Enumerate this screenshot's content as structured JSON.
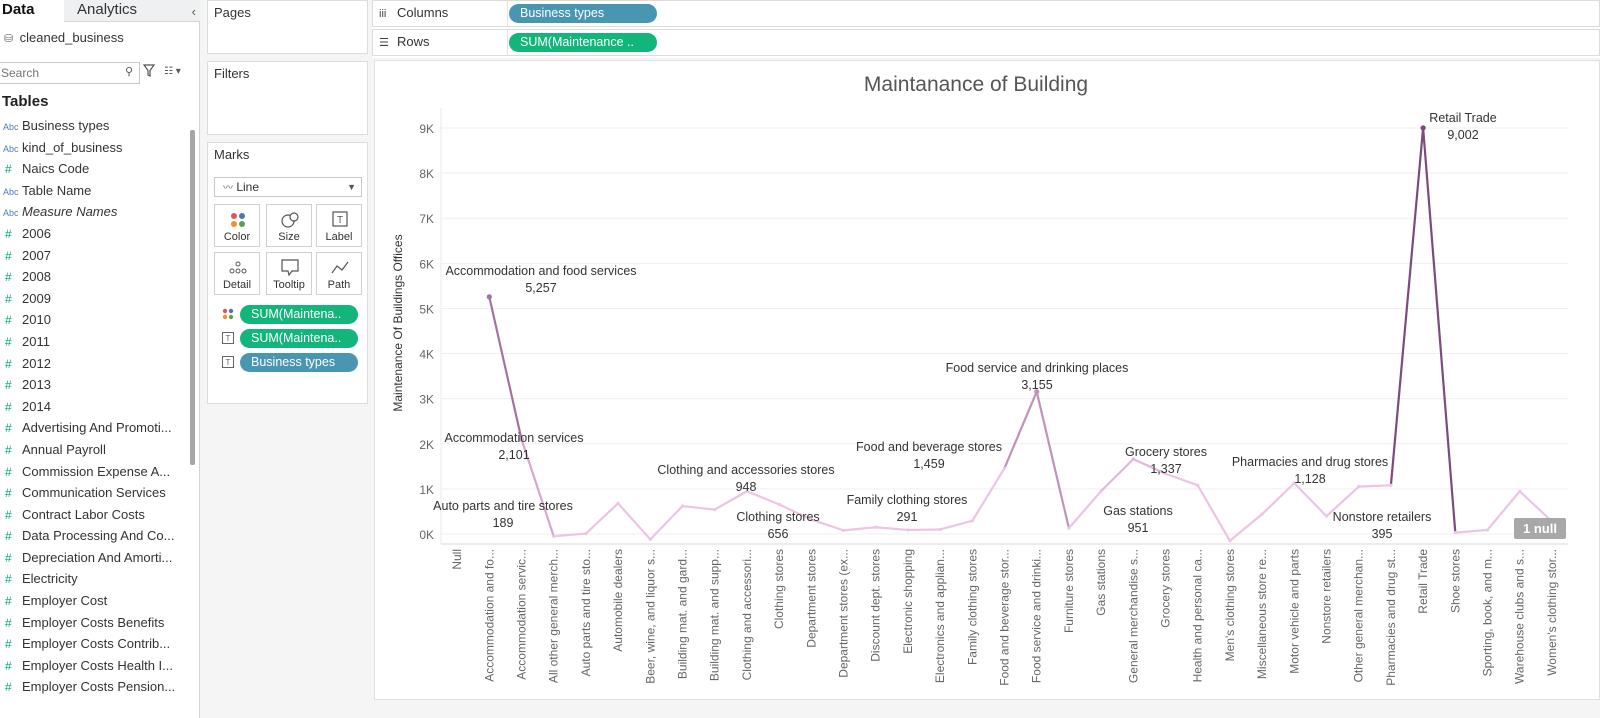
{
  "data_pane": {
    "tabs": [
      "Data",
      "Analytics"
    ],
    "collapse_glyph": "‹",
    "datasource": "cleaned_business",
    "search_placeholder": "Search",
    "tables_title": "Tables",
    "fields": [
      {
        "type": "Abc",
        "name": "Business types",
        "italic": false
      },
      {
        "type": "Abc",
        "name": "kind_of_business",
        "italic": false
      },
      {
        "type": "#",
        "name": "Naics Code",
        "italic": false
      },
      {
        "type": "Abc",
        "name": "Table Name",
        "italic": false
      },
      {
        "type": "Abc",
        "name": "Measure Names",
        "italic": true
      },
      {
        "type": "#",
        "name": "2006",
        "italic": false
      },
      {
        "type": "#",
        "name": "2007",
        "italic": false
      },
      {
        "type": "#",
        "name": "2008",
        "italic": false
      },
      {
        "type": "#",
        "name": "2009",
        "italic": false
      },
      {
        "type": "#",
        "name": "2010",
        "italic": false
      },
      {
        "type": "#",
        "name": "2011",
        "italic": false
      },
      {
        "type": "#",
        "name": "2012",
        "italic": false
      },
      {
        "type": "#",
        "name": "2013",
        "italic": false
      },
      {
        "type": "#",
        "name": "2014",
        "italic": false
      },
      {
        "type": "#",
        "name": "Advertising And Promoti...",
        "italic": false
      },
      {
        "type": "#",
        "name": "Annual Payroll",
        "italic": false
      },
      {
        "type": "#",
        "name": "Commission Expense A...",
        "italic": false
      },
      {
        "type": "#",
        "name": "Communication Services",
        "italic": false
      },
      {
        "type": "#",
        "name": "Contract Labor Costs",
        "italic": false
      },
      {
        "type": "#",
        "name": "Data Processing And Co...",
        "italic": false
      },
      {
        "type": "#",
        "name": "Depreciation And Amorti...",
        "italic": false
      },
      {
        "type": "#",
        "name": "Electricity",
        "italic": false
      },
      {
        "type": "#",
        "name": "Employer Cost",
        "italic": false
      },
      {
        "type": "#",
        "name": "Employer Costs Benefits",
        "italic": false
      },
      {
        "type": "#",
        "name": "Employer Costs Contrib...",
        "italic": false
      },
      {
        "type": "#",
        "name": "Employer Costs Health I...",
        "italic": false
      },
      {
        "type": "#",
        "name": "Employer Costs Pension...",
        "italic": false
      }
    ]
  },
  "shelves": {
    "pages": "Pages",
    "filters": "Filters",
    "marks": "Marks",
    "mark_type": "Line",
    "mark_buttons": [
      "Color",
      "Size",
      "Label",
      "Detail",
      "Tooltip",
      "Path"
    ],
    "mark_pills": [
      "SUM(Maintena..",
      "SUM(Maintena..",
      "Business types"
    ],
    "columns_label": "Columns",
    "rows_label": "Rows",
    "columns_pill": "Business types",
    "rows_pill": "SUM(Maintenance .."
  },
  "colors": {
    "green_pill": "#12b57a",
    "blue_pill": "#4996b2",
    "line_low": "#ecc4e4",
    "line_high": "#7d4a7c"
  },
  "null_badge": "1 null",
  "chart_data": {
    "type": "line",
    "title": "Maintanance of Building",
    "xlabel": "",
    "ylabel": "Maintenance Of Buildings Offices",
    "ylim": [
      0,
      9500
    ],
    "y_ticks": [
      "0K",
      "1K",
      "2K",
      "3K",
      "4K",
      "5K",
      "6K",
      "7K",
      "8K",
      "9K"
    ],
    "categories": [
      "Null",
      "Accommodation and fo...",
      "Accommodation servic...",
      "All other general merch...",
      "Auto parts and tire sto...",
      "Automobile dealers",
      "Beer, wine, and liquor s...",
      "Building mat. and gard...",
      "Building mat. and supp...",
      "Clothing and accessori...",
      "Clothing stores",
      "Department stores",
      "Department stores (ex...",
      "Discount dept. stores",
      "Electronic shopping",
      "Electronics and applian...",
      "Family clothing stores",
      "Food and beverage stor...",
      "Food service and drinki...",
      "Furniture stores",
      "Gas stations",
      "General merchandise s...",
      "Grocery stores",
      "Health and personal ca...",
      "Men's clothing stores",
      "Miscellaneous store re...",
      "Motor vehicle and parts",
      "Nonstore retailers",
      "Other general merchan...",
      "Pharmacies and drug st...",
      "Retail Trade",
      "Shoe stores",
      "Sporting, book, and m...",
      "Warehouse clubs and s...",
      "Women's clothing stor..."
    ],
    "values": [
      null,
      5257,
      2101,
      -50,
      10,
      680,
      -120,
      620,
      540,
      948,
      656,
      320,
      80,
      150,
      90,
      100,
      291,
      1459,
      3155,
      130,
      951,
      1660,
      1337,
      1080,
      -150,
      440,
      1128,
      395,
      1050,
      1080,
      9002,
      30,
      90,
      948,
      280
    ],
    "data_labels": [
      {
        "category": "Accommodation and fo...",
        "name": "Accommodation and food services",
        "value": "5,257"
      },
      {
        "category": "Accommodation servic...",
        "name": "Accommodation services",
        "value": "2,101"
      },
      {
        "category": "Auto parts and tire sto...",
        "name": "Auto parts and tire stores",
        "value": "189"
      },
      {
        "category": "Clothing and accessori...",
        "name": "Clothing and accessories stores",
        "value": "948"
      },
      {
        "category": "Clothing stores",
        "name": "Clothing stores",
        "value": "656"
      },
      {
        "category": "Family clothing stores",
        "name": "Family clothing stores",
        "value": "291"
      },
      {
        "category": "Food and beverage stor...",
        "name": "Food and beverage stores",
        "value": "1,459"
      },
      {
        "category": "Food service and drinki...",
        "name": "Food service and drinking places",
        "value": "3,155"
      },
      {
        "category": "Gas stations",
        "name": "Gas stations",
        "value": "951"
      },
      {
        "category": "Grocery stores",
        "name": "Grocery stores",
        "value": "1,337"
      },
      {
        "category": "Pharmacies and drug st...",
        "name": "Pharmacies and drug stores",
        "value": "1,128"
      },
      {
        "category": "Nonstore retailers",
        "name": "Nonstore retailers",
        "value": "395"
      },
      {
        "category": "Retail Trade",
        "name": "Retail Trade",
        "value": "9,002"
      }
    ],
    "grid": true,
    "legend": "none"
  }
}
